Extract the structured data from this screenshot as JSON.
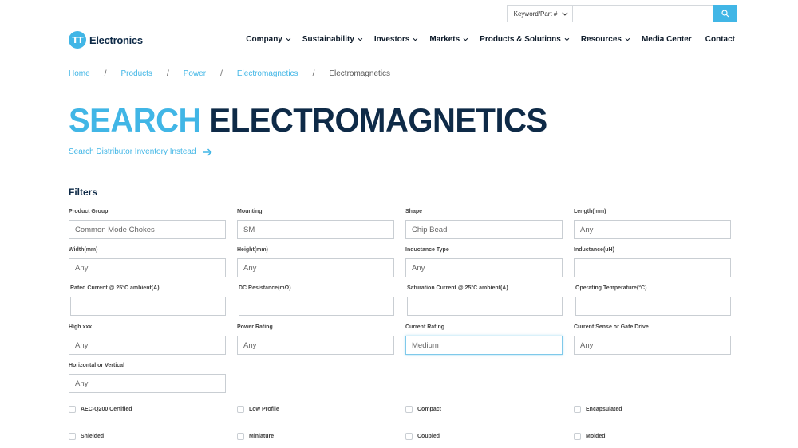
{
  "topsearch": {
    "select_label": "Keyword/Part #",
    "input_placeholder": ""
  },
  "header": {
    "logo_mark": "TT",
    "logo_text": "Electronics",
    "nav": [
      {
        "label": "Company",
        "dropdown": true
      },
      {
        "label": "Sustainability",
        "dropdown": true
      },
      {
        "label": "Investors",
        "dropdown": true
      },
      {
        "label": "Markets",
        "dropdown": true
      },
      {
        "label": "Products & Solutions",
        "dropdown": true
      },
      {
        "label": "Resources",
        "dropdown": true
      },
      {
        "label": "Media Center",
        "dropdown": false
      },
      {
        "label": "Contact",
        "dropdown": false
      }
    ]
  },
  "breadcrumb": [
    "Home",
    "Products",
    "Power",
    "Electromagnetics",
    "Electromagnetics"
  ],
  "title": {
    "part1": "SEARCH",
    "part2": "ELECTROMAGNETICS"
  },
  "distributor_link": "Search Distributor Inventory Instead",
  "filters": {
    "heading": "Filters",
    "fields": [
      {
        "label": "Product Group",
        "value": "Common Mode Chokes"
      },
      {
        "label": "Mounting",
        "value": "SM"
      },
      {
        "label": "Shape",
        "value": "Chip Bead"
      },
      {
        "label": "Length(mm)",
        "value": "Any"
      },
      {
        "label": "Width(mm)",
        "value": "Any"
      },
      {
        "label": "Height(mm)",
        "value": "Any"
      },
      {
        "label": "Inductance Type",
        "value": "Any"
      },
      {
        "label": "Inductance(uH)",
        "value": ""
      },
      {
        "label": "Rated Current @ 25°C ambient(A)",
        "value": ""
      },
      {
        "label": "DC Resistance(mΩ)",
        "value": ""
      },
      {
        "label": "Saturation Current @ 25°C ambient(A)",
        "value": ""
      },
      {
        "label": "Operating Temperature(°C)",
        "value": ""
      },
      {
        "label": "High xxx",
        "value": "Any"
      },
      {
        "label": "Power Rating",
        "value": "Any"
      },
      {
        "label": "Current Rating",
        "value": "Medium"
      },
      {
        "label": "Current Sense or Gate Drive",
        "value": "Any"
      },
      {
        "label": "Horizontal or Vertical",
        "value": "Any"
      }
    ],
    "checkboxes": [
      "AEC-Q200 Certified",
      "Low Profile",
      "Compact",
      "Encapsulated",
      "Shielded",
      "Miniature",
      "Coupled",
      "Molded"
    ]
  },
  "colors": {
    "accent": "#41b6e6",
    "navy": "#0e2a47"
  }
}
